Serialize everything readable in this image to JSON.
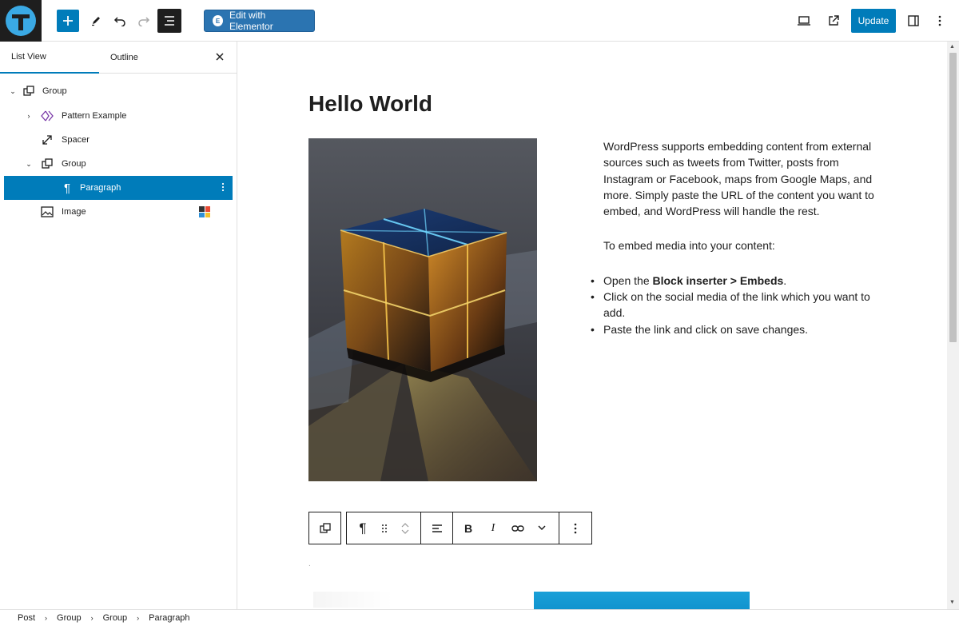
{
  "topbar": {
    "elementor_label": "Edit with Elementor",
    "update_label": "Update"
  },
  "sidebar": {
    "tabs": [
      "List View",
      "Outline"
    ],
    "items": [
      {
        "label": "Group",
        "icon": "group-icon",
        "expanded": true
      },
      {
        "label": "Pattern Example",
        "icon": "pattern-icon",
        "expanded": false
      },
      {
        "label": "Spacer",
        "icon": "spacer-icon"
      },
      {
        "label": "Group",
        "icon": "group-icon",
        "expanded": true
      },
      {
        "label": "Paragraph",
        "icon": "paragraph-icon",
        "selected": true
      },
      {
        "label": "Image",
        "icon": "image-icon"
      }
    ]
  },
  "post": {
    "title": "Hello World",
    "paragraph1": "WordPress supports embedding content from external sources such as tweets from Twitter, posts from Instagram or Facebook, maps from Google Maps, and more. Simply paste the URL of the content you want to embed, and WordPress will handle the rest.",
    "paragraph2": "To embed media into your content:",
    "list": {
      "item1_prefix": "Open the ",
      "item1_bold": "Block inserter > Embeds",
      "item1_suffix": ".",
      "item2": "Click on the social media of the link which you want to add.",
      "item3": "Paste the link and click on save changes."
    }
  },
  "breadcrumbs": [
    "Post",
    "Group",
    "Group",
    "Paragraph"
  ],
  "colors": {
    "accent": "#007cba",
    "elementor": "#2b74b1",
    "logo": "#3aa9e4"
  }
}
